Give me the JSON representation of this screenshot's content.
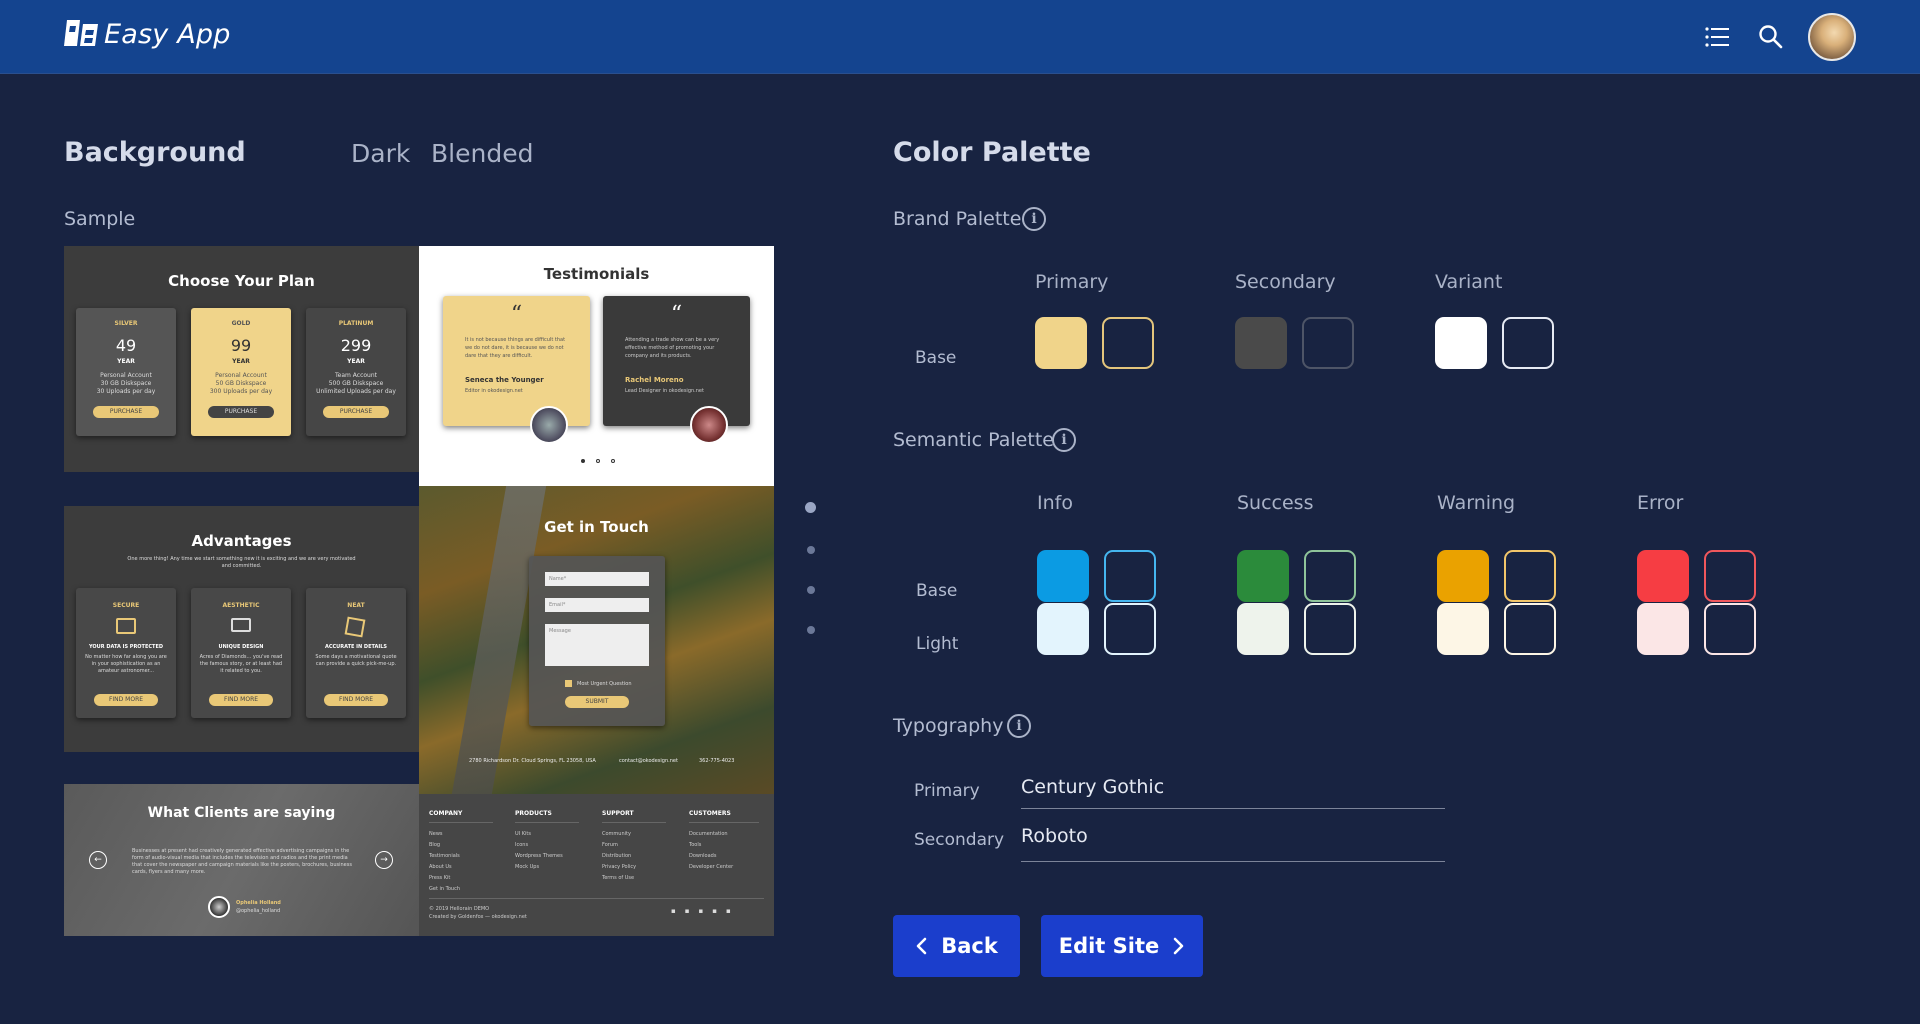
{
  "app": {
    "title": "Easy App"
  },
  "background": {
    "title": "Background",
    "tabs": [
      "Dark",
      "Blended"
    ],
    "sample_label": "Sample"
  },
  "sample": {
    "plans": {
      "title": "Choose Your Plan",
      "cards": [
        {
          "name": "SILVER",
          "price": "49",
          "period": "YEAR",
          "lines": [
            "Personal Account",
            "30 GB Diskspace",
            "30 Uploads per day"
          ],
          "button": "PURCHASE"
        },
        {
          "name": "GOLD",
          "price": "99",
          "period": "YEAR",
          "lines": [
            "Personal Account",
            "50 GB Diskspace",
            "300 Uploads per day"
          ],
          "button": "PURCHASE"
        },
        {
          "name": "PLATINUM",
          "price": "299",
          "period": "YEAR",
          "lines": [
            "Team Account",
            "500 GB Diskspace",
            "Unlimited Uploads per day"
          ],
          "button": "PURCHASE"
        }
      ]
    },
    "testimonials": {
      "title": "Testimonials",
      "items": [
        {
          "quote": "It is not because things are difficult that we do not dare, it is because we do not dare that they are difficult.",
          "name": "Seneca the Younger",
          "role": "Editor in okodesign.net"
        },
        {
          "quote": "Attending a trade show can be a very effective method of promoting your company and its products.",
          "name": "Rachel Moreno",
          "role": "Lead Designer in okodesign.net"
        }
      ]
    },
    "advantages": {
      "title": "Advantages",
      "subtitle": "One more thing! Any time we start something new it is exciting and we are very motivated and committed.",
      "cards": [
        {
          "name": "SECURE",
          "heading": "YOUR DATA IS PROTECTED",
          "text": "No matter how far along you are in your sophistication as an amateur astronomer...",
          "button": "FIND MORE"
        },
        {
          "name": "AESTHETIC",
          "heading": "UNIQUE DESIGN",
          "text": "Acres of Diamonds... you've read the famous story, or at least had it related to you.",
          "button": "FIND MORE"
        },
        {
          "name": "NEAT",
          "heading": "ACCURATE IN DETAILS",
          "text": "Some days a motivational quote can provide a quick pick-me-up.",
          "button": "FIND MORE"
        }
      ]
    },
    "contact": {
      "title": "Get in Touch",
      "name_ph": "Name*",
      "email_ph": "Email*",
      "message_ph": "Message",
      "checkbox": "Most Urgent Question",
      "submit": "SUBMIT",
      "address": "2780 Richardson Dr. Cloud Springs, FL 23058, USA",
      "email": "contact@okodesign.net",
      "phone": "362-775-4023"
    },
    "clients": {
      "title": "What Clients are saying",
      "text": "Businesses at present had creatively generated effective advertising campaigns in the form of audio-visual media that includes the television and radios and the print media that cover the newspaper and campaign materials like the posters, brochures, business cards, flyers and many more.",
      "name": "Ophelia Holland",
      "handle": "@ophelia_holland"
    },
    "footer": {
      "columns": [
        {
          "title": "COMPANY",
          "items": [
            "News",
            "Blog",
            "Testimonials",
            "About Us",
            "Press Kit",
            "Get in Touch"
          ]
        },
        {
          "title": "PRODUCTS",
          "items": [
            "UI Kits",
            "Icons",
            "Wordpress Themes",
            "Mock Ups"
          ]
        },
        {
          "title": "SUPPORT",
          "items": [
            "Community",
            "Forum",
            "Distribution",
            "Privacy Policy",
            "Terms of Use"
          ]
        },
        {
          "title": "CUSTOMERS",
          "items": [
            "Documentation",
            "Tools",
            "Downloads",
            "Developer Center"
          ]
        }
      ],
      "copyright": "© 2019 Hellorain DEMO",
      "credit": "Created by Goldenfox — okodesign.net"
    }
  },
  "palette": {
    "title": "Color Palette",
    "brand": {
      "title": "Brand Palette",
      "row_label": "Base",
      "columns": [
        {
          "name": "Primary",
          "fill": "#f0d48a",
          "outline": "#e3c57c"
        },
        {
          "name": "Secondary",
          "fill": "#4a4a4a",
          "outline": "#4e5567"
        },
        {
          "name": "Variant",
          "fill": "#ffffff",
          "outline": "#e6eaf3"
        }
      ]
    },
    "semantic": {
      "title": "Semantic Palette",
      "rows": [
        "Base",
        "Light"
      ],
      "columns": [
        {
          "name": "Info",
          "base": "#0b9be3",
          "base_outline": "#45b6ef",
          "light": "#e3f4fd",
          "light_outline": "#e3f4fd"
        },
        {
          "name": "Success",
          "base": "#2b8b3b",
          "base_outline": "#8fc49a",
          "light": "#eef3ec",
          "light_outline": "#eef3ec"
        },
        {
          "name": "Warning",
          "base": "#eaa200",
          "base_outline": "#f2c66a",
          "light": "#fdf6e6",
          "light_outline": "#fdf6e6"
        },
        {
          "name": "Error",
          "base": "#f63d43",
          "base_outline": "#f0575c",
          "light": "#fbe6e6",
          "light_outline": "#fbe6e6"
        }
      ]
    },
    "typography": {
      "title": "Typography",
      "primary_label": "Primary",
      "primary_value": "Century Gothic",
      "secondary_label": "Secondary",
      "secondary_value": "Roboto"
    }
  },
  "actions": {
    "back": "Back",
    "edit": "Edit Site"
  },
  "colors": {
    "topbar": "#14448f",
    "background": "#182341",
    "button": "#1b3ecc"
  }
}
